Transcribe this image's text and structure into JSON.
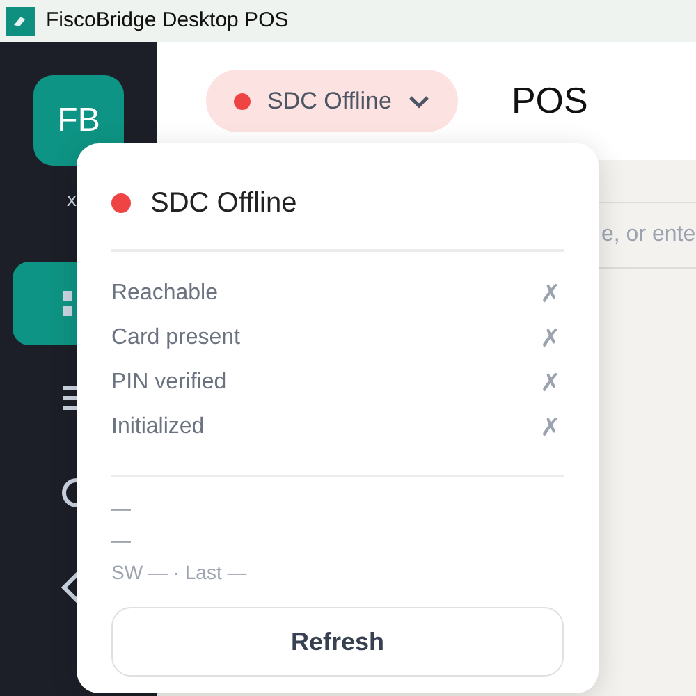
{
  "window": {
    "title": "FiscoBridge Desktop POS"
  },
  "sidebar": {
    "logo": "FB",
    "label_fragment": "x",
    "items": [
      {
        "kind": "grid",
        "selected": true
      },
      {
        "kind": "menu",
        "selected": false
      },
      {
        "kind": "circle",
        "selected": false
      },
      {
        "kind": "diamond",
        "selected": false
      }
    ]
  },
  "header": {
    "status_pill": {
      "label": "SDC Offline",
      "color": "#ef4444"
    },
    "title": "POS"
  },
  "search": {
    "placeholder": "e, or ente"
  },
  "status_popover": {
    "title": "SDC Offline",
    "color": "#ef4444",
    "checks": [
      {
        "label": "Reachable",
        "mark": "✗",
        "checked": false
      },
      {
        "label": "Card present",
        "mark": "✗",
        "checked": false
      },
      {
        "label": "PIN verified",
        "mark": "✗",
        "checked": false
      },
      {
        "label": "Initialized",
        "mark": "✗",
        "checked": false
      }
    ],
    "details": [
      "—",
      "—",
      "SW — · Last —"
    ],
    "button": "Refresh"
  }
}
